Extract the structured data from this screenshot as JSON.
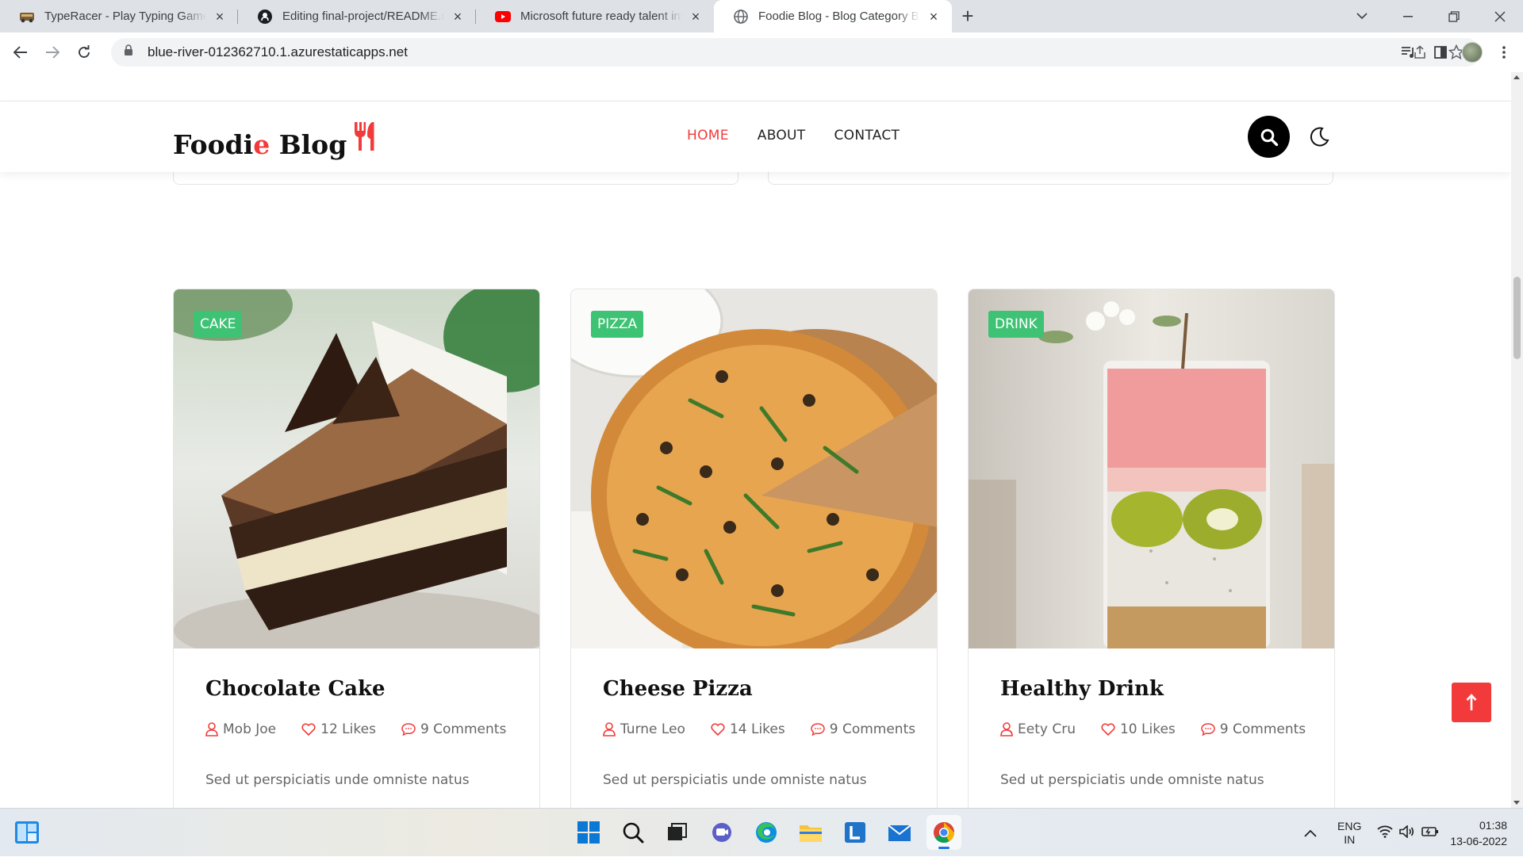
{
  "browser": {
    "tabs": [
      {
        "title": "TypeRacer - Play Typing Games and Race Friends",
        "icon": "typeracer-icon"
      },
      {
        "title": "Editing final-project/README.md",
        "icon": "github-icon"
      },
      {
        "title": "Microsoft future ready talent internship",
        "icon": "youtube-icon"
      },
      {
        "title": "Foodie Blog - Blog Category Book",
        "icon": "globe-icon"
      }
    ],
    "address": "blue-river-012362710.1.azurestaticapps.net"
  },
  "site": {
    "logo_main": "Foodi",
    "logo_accent": "e",
    "logo_rest": " Blog",
    "nav": {
      "home": "HOME",
      "about": "ABOUT",
      "contact": "CONTACT"
    }
  },
  "posts": [
    {
      "category": "CAKE",
      "title": "Chocolate Cake",
      "author": "Mob Joe",
      "likes": "12 Likes",
      "comments": "9 Comments",
      "excerpt": "Sed ut perspiciatis unde omniste natus"
    },
    {
      "category": "PIZZA",
      "title": "Cheese Pizza",
      "author": "Turne Leo",
      "likes": "14 Likes",
      "comments": "9 Comments",
      "excerpt": "Sed ut perspiciatis unde omniste natus"
    },
    {
      "category": "DRINK",
      "title": "Healthy Drink",
      "author": "Eety Cru",
      "likes": "10 Likes",
      "comments": "9 Comments",
      "excerpt": "Sed ut perspiciatis unde omniste natus"
    }
  ],
  "taskbar": {
    "lang_top": "ENG",
    "lang_bottom": "IN",
    "time": "01:38",
    "date": "13-06-2022"
  },
  "colors": {
    "accent": "#f23a3a",
    "badge": "#3ec274"
  }
}
